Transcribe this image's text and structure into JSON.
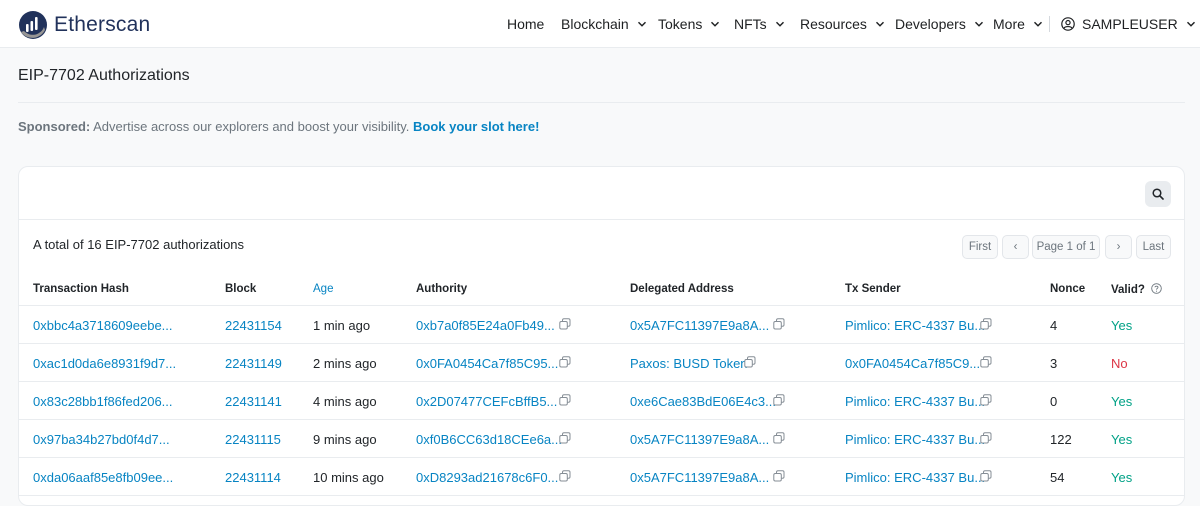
{
  "header": {
    "brand": "Etherscan",
    "nav": [
      {
        "label": "Home",
        "has_menu": false
      },
      {
        "label": "Blockchain",
        "has_menu": true
      },
      {
        "label": "Tokens",
        "has_menu": true
      },
      {
        "label": "NFTs",
        "has_menu": true
      },
      {
        "label": "Resources",
        "has_menu": true
      },
      {
        "label": "Developers",
        "has_menu": true
      },
      {
        "label": "More",
        "has_menu": true
      }
    ],
    "user": "SAMPLEUSER",
    "user_icon": "user-circle-icon"
  },
  "page": {
    "title": "EIP-7702 Authorizations",
    "sponsored_label": "Sponsored:",
    "sponsored_text": "Advertise across our explorers and boost your visibility.",
    "sponsored_link": "Book your slot here!"
  },
  "table": {
    "total_text": "A total of 16 EIP-7702 authorizations",
    "pagination": {
      "first": "First",
      "prev": "‹",
      "page": "Page 1 of 1",
      "next": "›",
      "last": "Last"
    },
    "columns": [
      "Transaction Hash",
      "Block",
      "Age",
      "Authority",
      "Delegated Address",
      "Tx Sender",
      "Nonce",
      "Valid?"
    ],
    "rows": [
      {
        "hash": "0xbbc4a3718609eebe...",
        "block": "22431154",
        "age": "1 min ago",
        "authority": "0xb7a0f85E24a0Fb49...",
        "delegated": "0x5A7FC11397E9a8A...",
        "sender": "Pimlico: ERC-4337 Bu...",
        "nonce": "4",
        "valid": "Yes"
      },
      {
        "hash": "0xac1d0da6e8931f9d7...",
        "block": "22431149",
        "age": "2 mins ago",
        "authority": "0x0FA0454Ca7f85C95...",
        "delegated": "Paxos: BUSD Token",
        "sender": "0x0FA0454Ca7f85C9...",
        "nonce": "3",
        "valid": "No"
      },
      {
        "hash": "0x83c28bb1f86fed206...",
        "block": "22431141",
        "age": "4 mins ago",
        "authority": "0x2D07477CEFcBffB5...",
        "delegated": "0xe6Cae83BdE06E4c3...",
        "sender": "Pimlico: ERC-4337 Bu...",
        "nonce": "0",
        "valid": "Yes"
      },
      {
        "hash": "0x97ba34b27bd0f4d7...",
        "block": "22431115",
        "age": "9 mins ago",
        "authority": "0xf0B6CC63d18CEe6a...",
        "delegated": "0x5A7FC11397E9a8A...",
        "sender": "Pimlico: ERC-4337 Bu...",
        "nonce": "122",
        "valid": "Yes"
      },
      {
        "hash": "0xda06aaf85e8fb09ee...",
        "block": "22431114",
        "age": "10 mins ago",
        "authority": "0xD8293ad21678c6F0...",
        "delegated": "0x5A7FC11397E9a8A...",
        "sender": "Pimlico: ERC-4337 Bu...",
        "nonce": "54",
        "valid": "Yes"
      }
    ]
  },
  "colors": {
    "link": "#0784c3",
    "valid_yes": "#00a186",
    "valid_no": "#dc3545",
    "brand": "#21325b"
  }
}
